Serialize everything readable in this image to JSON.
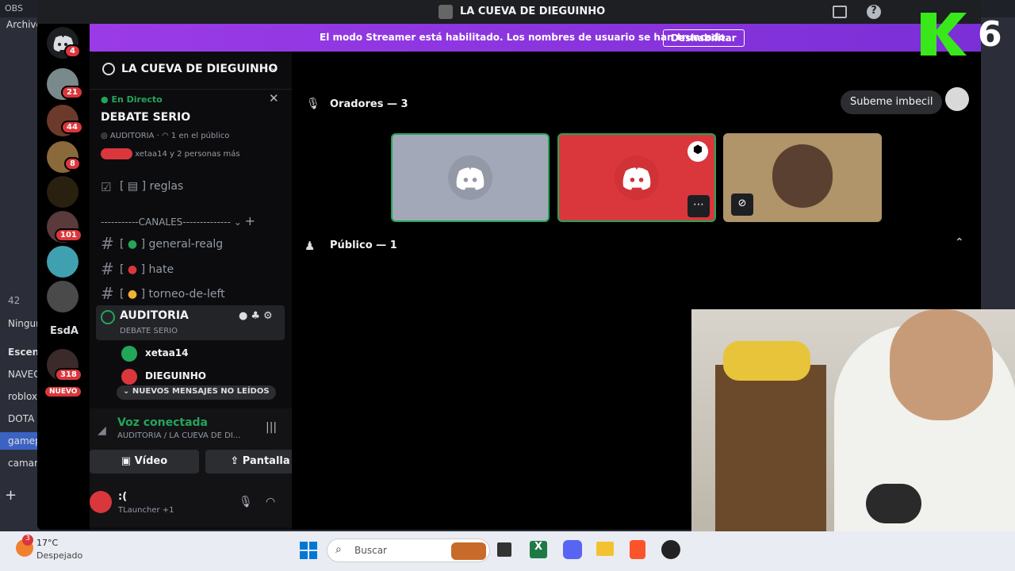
{
  "obs": {
    "title": "OBS",
    "menu": "Archivo",
    "items": [
      "Ningun",
      "Escena",
      "NAVEG",
      "roblox",
      "DOTA C",
      "gamep",
      "camar"
    ],
    "num": "42"
  },
  "window": {
    "title": "LA CUEVA DE DIEGUINHO"
  },
  "banner": {
    "message": "El modo Streamer está habilitado. Los nombres de usuario se han truncado.",
    "button": "Deshabilitar"
  },
  "guilds": {
    "badges": [
      "4",
      "21",
      "44",
      "8",
      "101",
      "318"
    ],
    "esda": "EsdA",
    "nuevo": "NUEVO"
  },
  "server": {
    "name": "LA CUEVA DE DIEGUINHO"
  },
  "stage": {
    "live": "En Directo",
    "title": "DEBATE SERIO",
    "channel": "AUDITORIA",
    "audience": "1 en el público",
    "users": "xetaa14 y 2 personas más"
  },
  "channels": {
    "rules": "reglas",
    "category": "-----------CANALES--------------",
    "general": "general-realg",
    "hate": "hate",
    "torneo": "torneo-de-left",
    "voice": "AUDITORIA",
    "voice_sub": "DEBATE SERIO",
    "user1": "xetaa14",
    "user2": "DIEGUINHO",
    "unread": "NUEVOS MENSAJES NO LEÍDOS"
  },
  "voice": {
    "status": "Voz conectada",
    "location": "AUDITORIA",
    "location2": "/ LA CUEVA DE DI...",
    "video": "Vídeo",
    "screen": "Pantalla"
  },
  "user": {
    "name": ":(",
    "activity": "TLauncher +1"
  },
  "main": {
    "speakers": "Oradores — 3",
    "audience": "Público — 1",
    "promote": "Subeme imbecil"
  },
  "taskbar": {
    "weather_temp": "17°C",
    "weather_desc": "Despejado",
    "search": "Buscar",
    "notif": "3"
  },
  "colors": {
    "blurple": "#5865f2",
    "red": "#da373c",
    "green": "#23a55a",
    "purple": "#8a2be2"
  }
}
